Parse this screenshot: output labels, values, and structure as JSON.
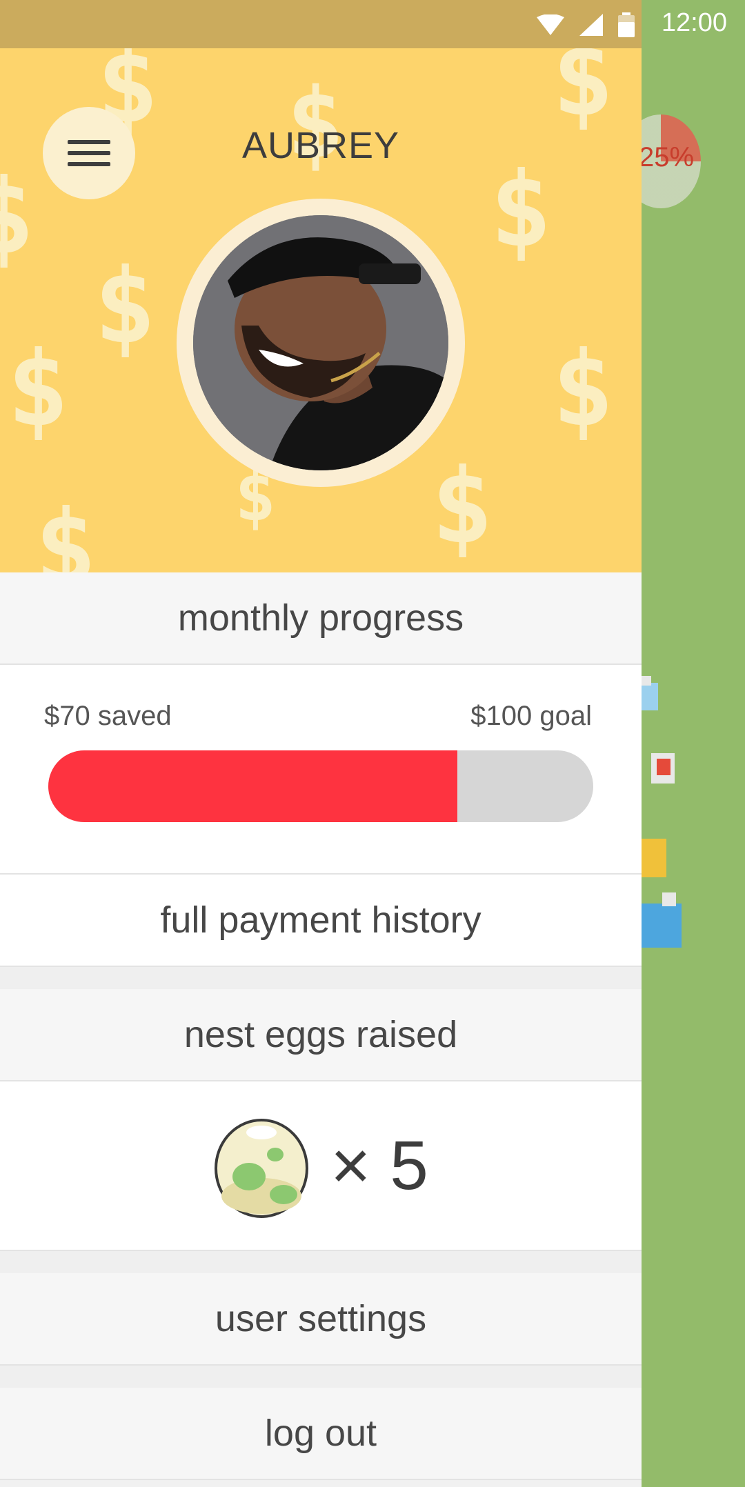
{
  "status_bar": {
    "time": "12:00"
  },
  "behind": {
    "pie_label": "25%"
  },
  "drawer": {
    "user_name": "AUBREY",
    "sections": {
      "monthly_progress": "monthly progress",
      "saved_label": "$70 saved",
      "goal_label": "$100 goal",
      "progress_fraction": 0.75,
      "payment_history": "full payment history",
      "nest_eggs": "nest eggs raised",
      "egg_count": "× 5",
      "user_settings": "user settings",
      "log_out": "log out"
    }
  },
  "colors": {
    "header_yellow": "#fdd46c",
    "progress_red": "#fe3340",
    "progress_track": "#d6d6d6",
    "background_green": "#93bb6a"
  },
  "icons": [
    "wifi-icon",
    "signal-icon",
    "battery-icon",
    "menu-icon",
    "egg-icon"
  ]
}
